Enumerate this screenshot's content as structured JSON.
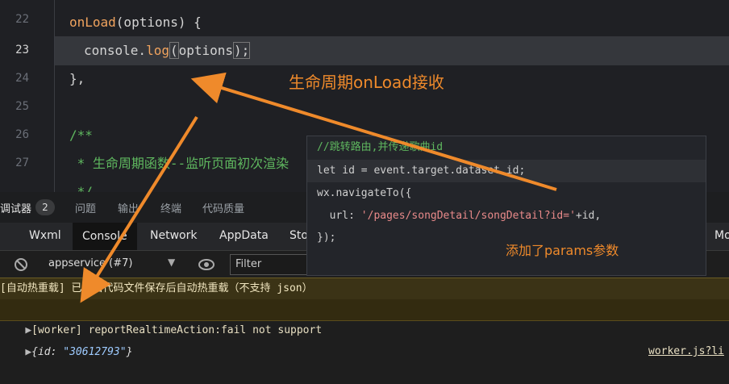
{
  "editor": {
    "line_numbers": [
      "22",
      "23",
      "24",
      "25",
      "26",
      "27"
    ],
    "lines": {
      "l22_name": "onLoad",
      "l22_rest": "(options) {",
      "l23_obj": "console.",
      "l23_fn": "log",
      "l23_arg": "options",
      "l23_end": ");",
      "l24": "},",
      "l26": "/**",
      "l27": " * 生命周期函数--监听页面初次渲染",
      "l28": " */"
    }
  },
  "tooltip": {
    "comment": "//跳转路由,并传递歌曲id",
    "line2": "let id = event.target.dataset.id;",
    "line3": "wx.navigateTo({",
    "line4_key": "  url: ",
    "line4_str": "'/pages/songDetail/songDetail?id='",
    "line4_rest": "+id,",
    "line5": "});"
  },
  "annotations": {
    "onload_label": "生命周期onLoad接收",
    "params_label": "添加了params参数"
  },
  "devtools": {
    "debugger_label": "调试器",
    "badge_count": "2",
    "tabs": [
      "问题",
      "输出",
      "终端",
      "代码质量"
    ],
    "subtabs": [
      "Wxml",
      "Console",
      "Network",
      "AppData",
      "Sto",
      "Mo"
    ],
    "context": "appservice (#7)",
    "filter_placeholder": "Filter",
    "console": {
      "line1": "[自动热重载] 已开启代码文件保存后自动热重载（不支持 json）",
      "line2": "[worker] reportRealtimeAction:fail not support",
      "line2_link": "worker.js?li",
      "line3_prefix": "{id: ",
      "line3_value": "\"30612793\"",
      "line3_suffix": "}"
    }
  },
  "colors": {
    "accent": "#ef8a2b",
    "keyword": "#f0a35e",
    "comment": "#5fb85f"
  }
}
